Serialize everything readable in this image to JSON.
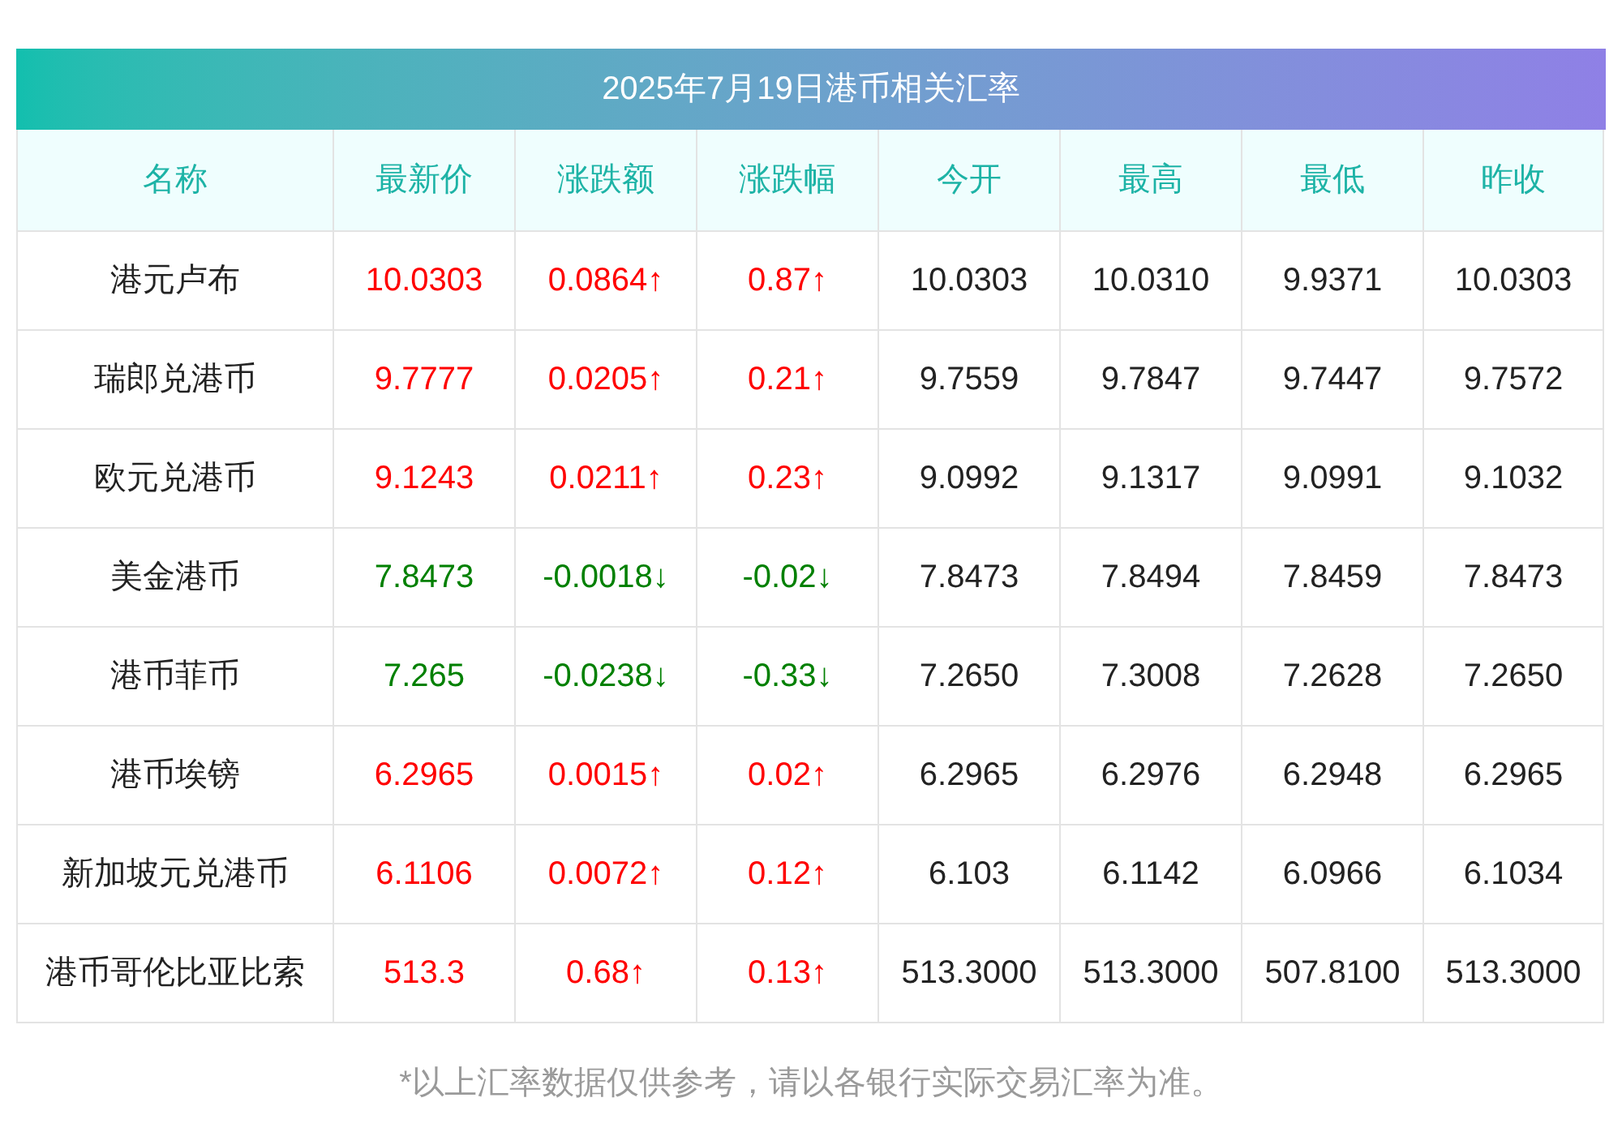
{
  "title": "2025年7月19日港币相关汇率",
  "columns": [
    "名称",
    "最新价",
    "涨跌额",
    "涨跌幅",
    "今开",
    "最高",
    "最低",
    "昨收"
  ],
  "rows": [
    {
      "kind": "up",
      "cells": [
        "港元卢布",
        "10.0303",
        "0.0864↑",
        "0.87↑",
        "10.0303",
        "10.0310",
        "9.9371",
        "10.0303"
      ]
    },
    {
      "kind": "up",
      "cells": [
        "瑞郎兑港币",
        "9.7777",
        "0.0205↑",
        "0.21↑",
        "9.7559",
        "9.7847",
        "9.7447",
        "9.7572"
      ]
    },
    {
      "kind": "up",
      "cells": [
        "欧元兑港币",
        "9.1243",
        "0.0211↑",
        "0.23↑",
        "9.0992",
        "9.1317",
        "9.0991",
        "9.1032"
      ]
    },
    {
      "kind": "down",
      "cells": [
        "美金港币",
        "7.8473",
        "-0.0018↓",
        "-0.02↓",
        "7.8473",
        "7.8494",
        "7.8459",
        "7.8473"
      ]
    },
    {
      "kind": "down",
      "cells": [
        "港币菲币",
        "7.265",
        "-0.0238↓",
        "-0.33↓",
        "7.2650",
        "7.3008",
        "7.2628",
        "7.2650"
      ]
    },
    {
      "kind": "up",
      "cells": [
        "港币埃镑",
        "6.2965",
        "0.0015↑",
        "0.02↑",
        "6.2965",
        "6.2976",
        "6.2948",
        "6.2965"
      ]
    },
    {
      "kind": "up",
      "cells": [
        "新加坡元兑港币",
        "6.1106",
        "0.0072↑",
        "0.12↑",
        "6.103",
        "6.1142",
        "6.0966",
        "6.1034"
      ]
    },
    {
      "kind": "up",
      "cells": [
        "港币哥伦比亚比索",
        "513.3",
        "0.68↑",
        "0.13↑",
        "513.3000",
        "513.3000",
        "507.8100",
        "513.3000"
      ]
    }
  ],
  "footnote": "*以上汇率数据仅供参考，请以各银行实际交易汇率为准。"
}
